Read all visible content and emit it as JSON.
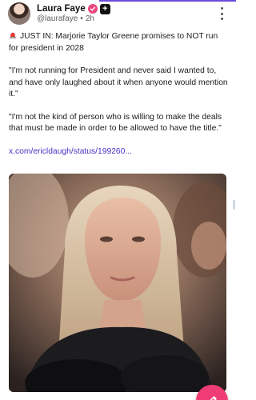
{
  "post": {
    "author_name": "Laura Faye",
    "handle": "@laurafaye",
    "separator": "•",
    "time": "2h",
    "paragraphs": [
      "JUST IN: Marjorie Taylor Greene promises to NOT run for president in 2028",
      "\"I'm not running for President and never said I wanted to, and have only laughed about it when anyone would mention it.\"",
      "\"I'm not the kind of person who is willing to make the deals that must be made in order to be allowed to have the title.\""
    ],
    "link_text": "x.com/ericldaugh/status/199260..."
  },
  "icons": {
    "avatar": "avatar",
    "verified": "verified-badge-icon",
    "plus": "plus-badge-icon",
    "more": "more-options-icon",
    "alert": "police-light-icon",
    "compose": "compose-pencil-icon"
  },
  "colors": {
    "accent": "#6c4bdc",
    "link": "#4b2ec4",
    "verified": "#e8467f",
    "fab": "#f03c75"
  }
}
